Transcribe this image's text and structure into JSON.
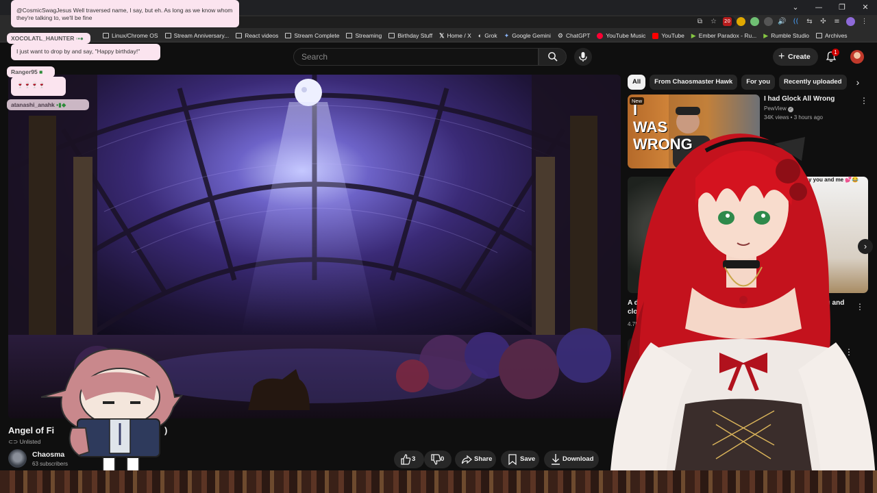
{
  "browser": {
    "bookmarks": [
      {
        "label": "Linux/Chrome OS",
        "icon": "folder-icon"
      },
      {
        "label": "Stream Anniversary...",
        "icon": "folder-icon"
      },
      {
        "label": "React videos",
        "icon": "folder-icon"
      },
      {
        "label": "Stream Complete",
        "icon": "folder-icon"
      },
      {
        "label": "Streaming",
        "icon": "folder-icon"
      },
      {
        "label": "Birthday Stuff",
        "icon": "folder-icon"
      },
      {
        "label": "Home / X",
        "icon": "x-icon"
      },
      {
        "label": "Grok",
        "icon": "grok-icon"
      },
      {
        "label": "Google Gemini",
        "icon": "gemini-icon"
      },
      {
        "label": "ChatGPT",
        "icon": "chatgpt-icon"
      },
      {
        "label": "YouTube Music",
        "icon": "youtube-music-icon"
      },
      {
        "label": "YouTube",
        "icon": "youtube-icon"
      },
      {
        "label": "Ember Paradox - Ru...",
        "icon": "rumble-icon"
      },
      {
        "label": "Rumble Studio",
        "icon": "rumble-icon"
      },
      {
        "label": "Archives",
        "icon": "folder-icon"
      }
    ],
    "extension_badge": "20",
    "window_controls": [
      "⌄",
      "—",
      "❐",
      "✕"
    ]
  },
  "header": {
    "search_placeholder": "Search",
    "create_label": "Create",
    "notification_count": "1"
  },
  "video": {
    "title": "Angel of Fi",
    "title_tail": ")",
    "visibility": "Unlisted",
    "channel_name": "Chaosma",
    "subscribers": "63 subscribers",
    "likes": "3",
    "dislikes": "0",
    "share_label": "Share",
    "save_label": "Save",
    "download_label": "Download"
  },
  "sidebar": {
    "chips": [
      "All",
      "From Chaosmaster Hawk",
      "For you",
      "Recently uploaded"
    ],
    "recommendations": [
      {
        "title": "I had Glock All Wrong",
        "channel": "PewView",
        "meta": "34K views • 3 hours ago",
        "badge": "New",
        "thumb_text": "I WAS WRONG"
      },
      {
        "title_line1": "A dog in",
        "title_line2": "clothing",
        "meta": "4.7M",
        "title_right_line1": "you and",
        "title_right_line2": "...",
        "thumb_caption": "y you and me 💕😂"
      }
    ]
  },
  "chat_overlay": [
    {
      "name": "",
      "message": "@CosmicSwagJesus Well traversed name, I say, but eh. As long as we know whom they're talking to, we'll be fine"
    },
    {
      "name": "XOCOLATL_HAUNTER",
      "message": "I just want to drop by and say, \"Happy birthday!\""
    },
    {
      "name": "Ranger95",
      "message": "🍷🍷🍷🍷"
    },
    {
      "name": "atanashi_anahk",
      "message": ""
    }
  ],
  "colors": {
    "youtube_bg": "#0f0f0f",
    "pill_bg": "#272727",
    "accent_red": "#cc0000",
    "chat_bubble_bg": "#fbe4ef"
  }
}
